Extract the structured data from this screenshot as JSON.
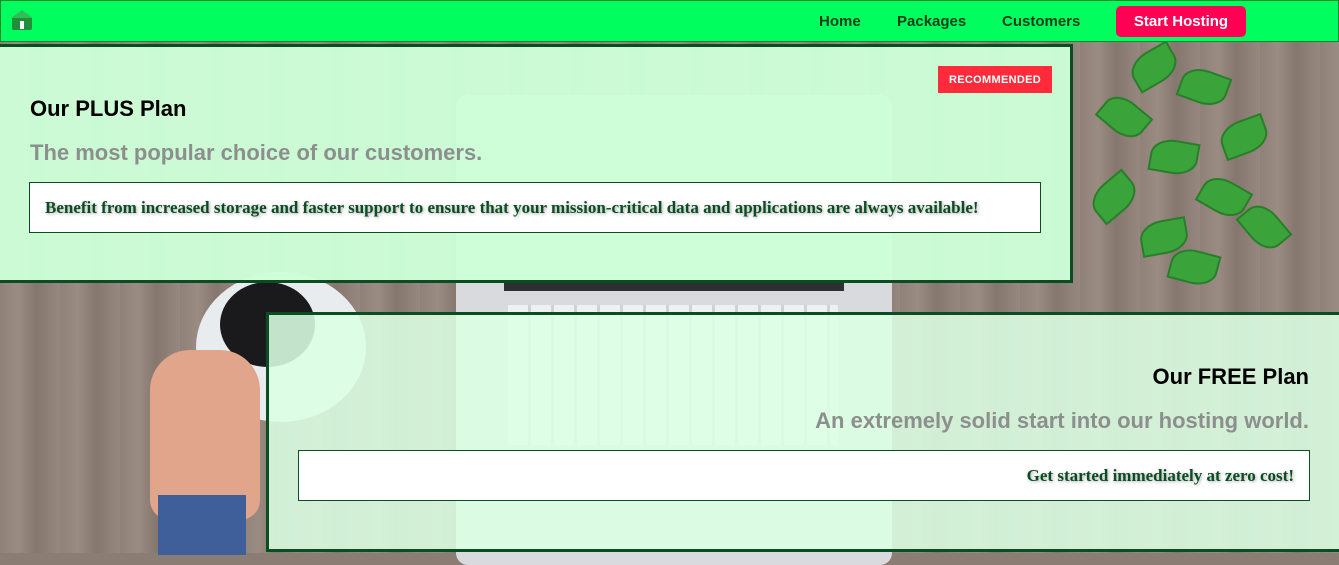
{
  "nav": {
    "logo": "house-logo-icon",
    "links": [
      "Home",
      "Packages",
      "Customers"
    ],
    "cta_label": "Start Hosting"
  },
  "plans": [
    {
      "badge": "RECOMMENDED",
      "title": "Our PLUS Plan",
      "subtitle": "The most popular choice of our customers.",
      "description": "Benefit from increased storage and faster support to ensure that your mission-critical data and applications are always available!"
    },
    {
      "title": "Our FREE Plan",
      "subtitle": "An extremely solid start into our hosting world.",
      "description": "Get started immediately at zero cost!"
    }
  ],
  "colors": {
    "navbar": "#00ff5e",
    "cta": "#ff0055",
    "badge": "#ff2a3a",
    "card_border": "#0b4d22",
    "subtitle": "#8c8f8d"
  }
}
